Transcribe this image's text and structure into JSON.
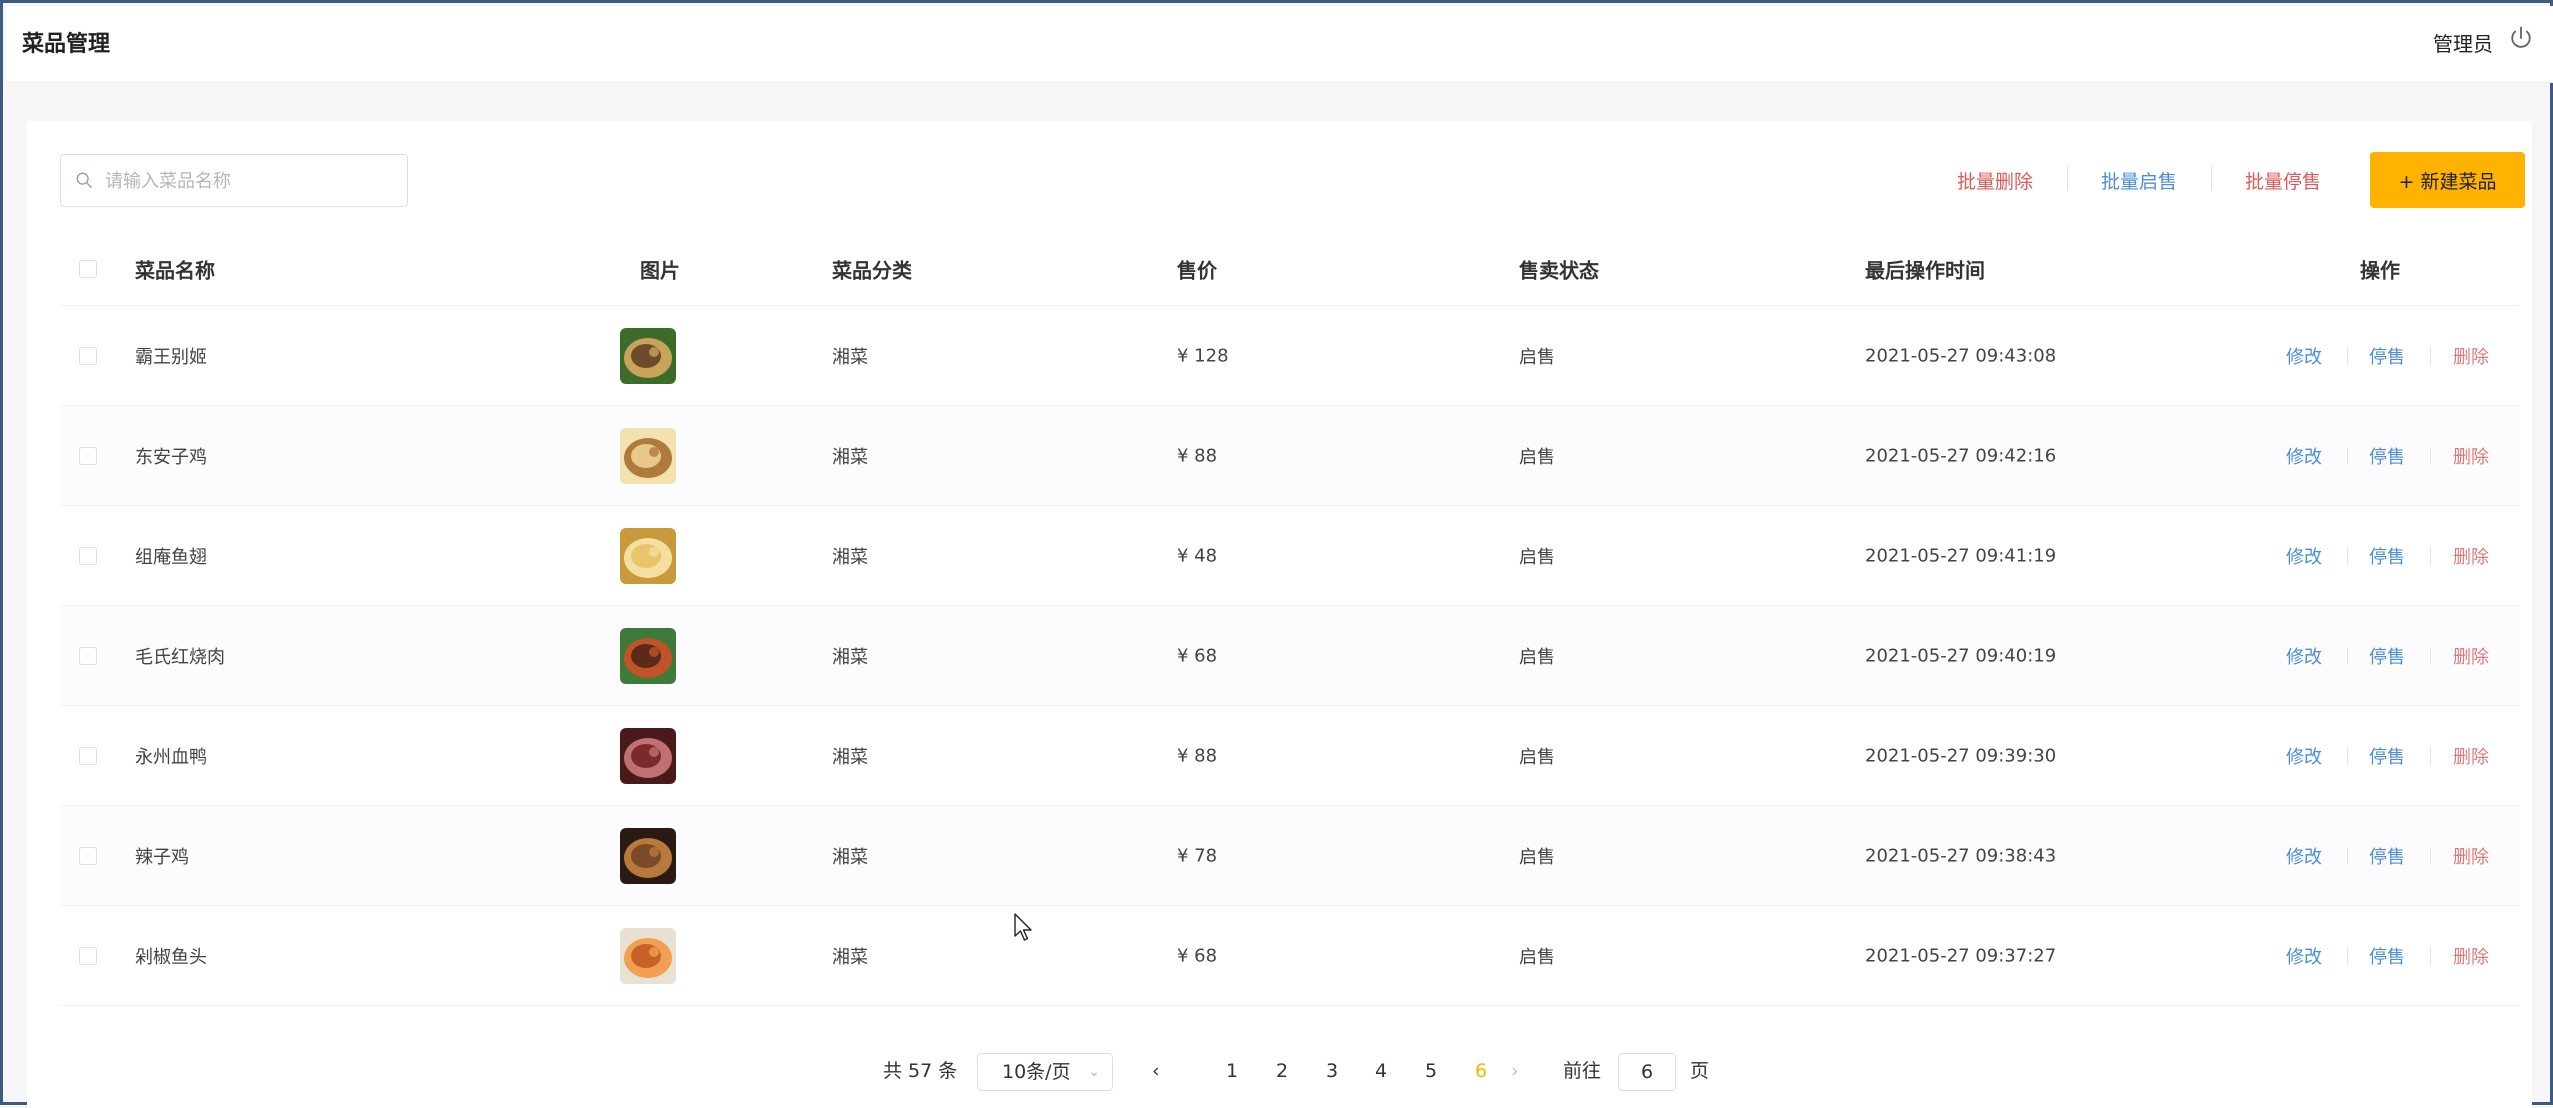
{
  "header": {
    "title": "菜品管理",
    "user": "管理员"
  },
  "toolbar": {
    "search_placeholder": "请输入菜品名称",
    "batch_delete": "批量删除",
    "batch_enable": "批量启售",
    "batch_disable": "批量停售",
    "new_button": "+ 新建菜品"
  },
  "table": {
    "columns": {
      "name": "菜品名称",
      "image": "图片",
      "category": "菜品分类",
      "price": "售价",
      "status": "售卖状态",
      "updated": "最后操作时间",
      "ops": "操作"
    },
    "ops": {
      "edit": "修改",
      "stop": "停售",
      "delete": "删除"
    },
    "rows": [
      {
        "name": "霸王别姬",
        "category": "湘菜",
        "price": "¥ 128",
        "status": "启售",
        "updated": "2021-05-27 09:43:08"
      },
      {
        "name": "东安子鸡",
        "category": "湘菜",
        "price": "¥ 88",
        "status": "启售",
        "updated": "2021-05-27 09:42:16"
      },
      {
        "name": "组庵鱼翅",
        "category": "湘菜",
        "price": "¥ 48",
        "status": "启售",
        "updated": "2021-05-27 09:41:19"
      },
      {
        "name": "毛氏红烧肉",
        "category": "湘菜",
        "price": "¥ 68",
        "status": "启售",
        "updated": "2021-05-27 09:40:19"
      },
      {
        "name": "永州血鸭",
        "category": "湘菜",
        "price": "¥ 88",
        "status": "启售",
        "updated": "2021-05-27 09:39:30"
      },
      {
        "name": "辣子鸡",
        "category": "湘菜",
        "price": "¥ 78",
        "status": "启售",
        "updated": "2021-05-27 09:38:43"
      },
      {
        "name": "剁椒鱼头",
        "category": "湘菜",
        "price": "¥ 68",
        "status": "启售",
        "updated": "2021-05-27 09:37:27"
      }
    ]
  },
  "pagination": {
    "total": "共 57 条",
    "page_size": "10条/页",
    "pages": [
      "1",
      "2",
      "3",
      "4",
      "5",
      "6"
    ],
    "current": "6",
    "goto_prefix": "前往",
    "goto_value": "6",
    "goto_suffix": "页"
  },
  "colors": {
    "accent": "#ffb300",
    "link": "#4a8fd8",
    "danger": "#e05a5a"
  }
}
